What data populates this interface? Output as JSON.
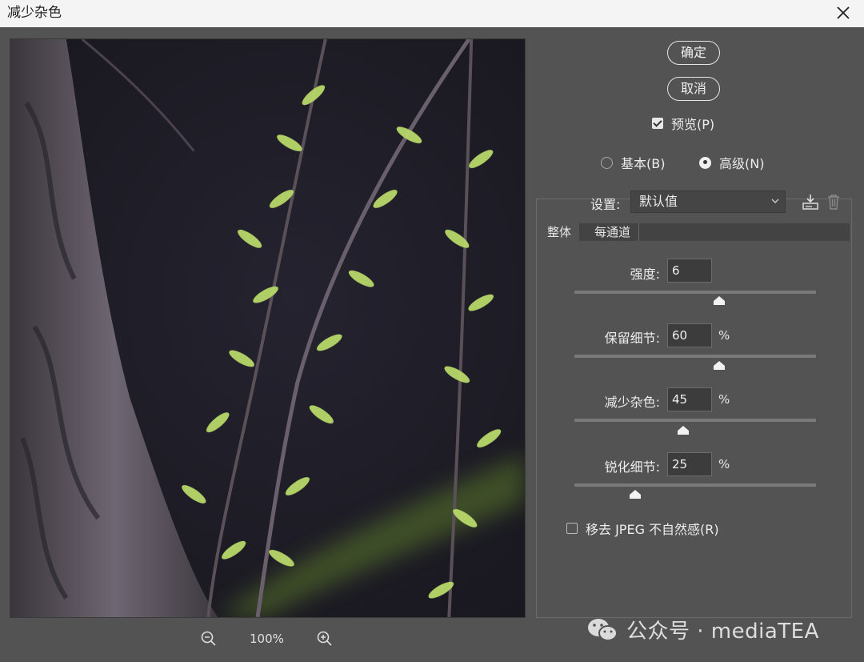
{
  "window": {
    "title": "减少杂色"
  },
  "buttons": {
    "ok": "确定",
    "cancel": "取消"
  },
  "preview_check": {
    "label": "预览(P)",
    "checked": true
  },
  "mode": {
    "basic": "基本(B)",
    "advanced": "高级(N)",
    "selected": "advanced"
  },
  "settings": {
    "label": "设置:",
    "value": "默认值"
  },
  "tabs": [
    {
      "label": "整体"
    },
    {
      "label": "每通道"
    }
  ],
  "sliders": [
    {
      "label": "强度:",
      "value": "6",
      "unit": "",
      "fraction": 0.6
    },
    {
      "label": "保留细节:",
      "value": "60",
      "unit": "%",
      "fraction": 0.6
    },
    {
      "label": "减少杂色:",
      "value": "45",
      "unit": "%",
      "fraction": 0.45
    },
    {
      "label": "锐化细节:",
      "value": "25",
      "unit": "%",
      "fraction": 0.25
    }
  ],
  "jpeg_check": {
    "label": "移去 JPEG 不自然感(R)",
    "checked": false
  },
  "zoom": {
    "value": "100%"
  },
  "watermark": {
    "text": "公众号 · mediaTEA"
  }
}
